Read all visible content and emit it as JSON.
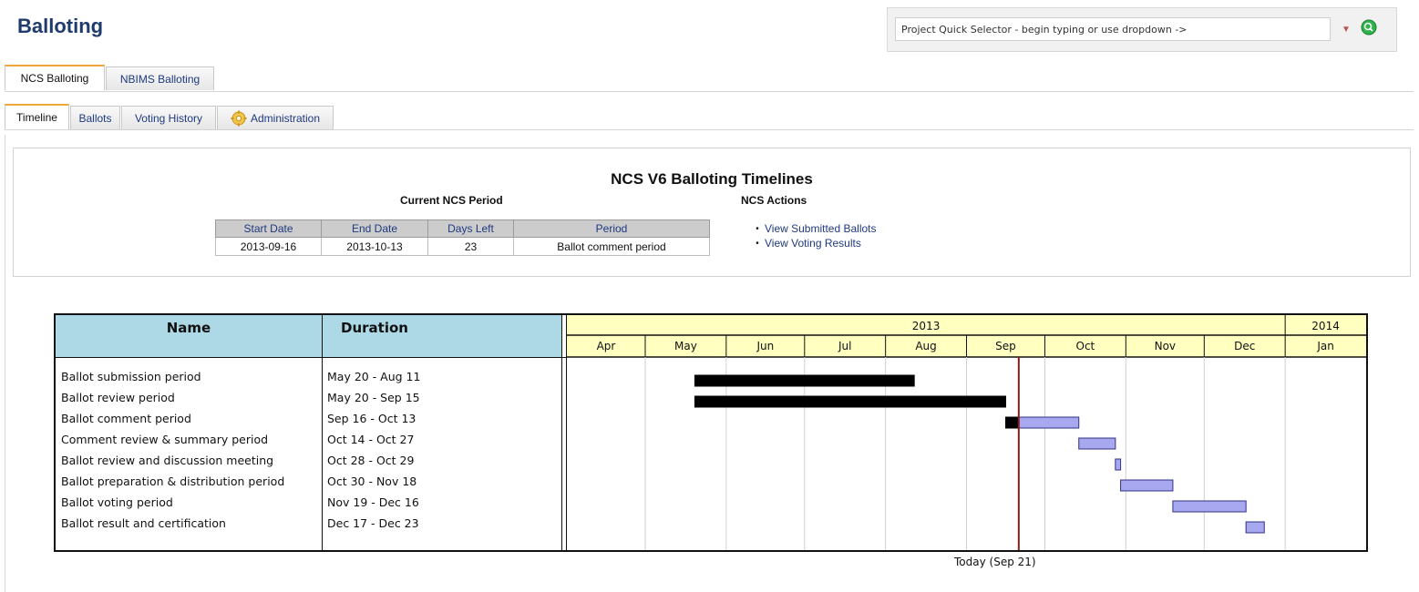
{
  "page": {
    "title": "Balloting"
  },
  "selector": {
    "placeholder": "Project Quick Selector - begin typing or use dropdown ->",
    "value": ""
  },
  "top_tabs": [
    {
      "label": "NCS Balloting",
      "active": true
    },
    {
      "label": "NBIMS Balloting",
      "active": false
    }
  ],
  "sub_tabs": [
    {
      "label": "Timeline",
      "active": true
    },
    {
      "label": "Ballots",
      "active": false
    },
    {
      "label": "Voting History",
      "active": false
    },
    {
      "label": "Administration",
      "active": false,
      "icon": "gear-icon"
    }
  ],
  "panel": {
    "title": "NCS V6 Balloting Timelines",
    "current_period_heading": "Current NCS Period",
    "actions_heading": "NCS Actions",
    "table": {
      "headers": [
        "Start Date",
        "End Date",
        "Days Left",
        "Period"
      ],
      "row": [
        "2013-09-16",
        "2013-10-13",
        "23",
        "Ballot comment period"
      ]
    },
    "actions": [
      "View Submitted Ballots",
      "View Voting Results"
    ]
  },
  "gantt": {
    "name_header": "Name",
    "duration_header": "Duration",
    "years": [
      {
        "label": "2013",
        "from": "2013-04-01",
        "to": "2014-01-01"
      },
      {
        "label": "2014",
        "from": "2014-01-01",
        "to": "2014-02-01"
      }
    ],
    "months": [
      "Apr",
      "May",
      "Jun",
      "Jul",
      "Aug",
      "Sep",
      "Oct",
      "Nov",
      "Dec",
      "Jan"
    ],
    "axis_start": "2013-04-01",
    "axis_end": "2014-02-01",
    "today": "2013-09-21",
    "today_label": "Today (Sep 21)",
    "tasks": [
      {
        "name": "Ballot submission period",
        "duration": "May 20 - Aug 11",
        "start": "2013-05-20",
        "end": "2013-08-11"
      },
      {
        "name": "Ballot review period",
        "duration": "May 20 - Sep 15",
        "start": "2013-05-20",
        "end": "2013-09-15"
      },
      {
        "name": "Ballot comment period",
        "duration": "Sep 16 - Oct 13",
        "start": "2013-09-16",
        "end": "2013-10-13"
      },
      {
        "name": "Comment review & summary period",
        "duration": "Oct 14 - Oct 27",
        "start": "2013-10-14",
        "end": "2013-10-27"
      },
      {
        "name": "Ballot review and discussion meeting",
        "duration": "Oct 28 - Oct 29",
        "start": "2013-10-28",
        "end": "2013-10-29"
      },
      {
        "name": "Ballot preparation & distribution period",
        "duration": "Oct 30 - Nov 18",
        "start": "2013-10-30",
        "end": "2013-11-18"
      },
      {
        "name": "Ballot voting period",
        "duration": "Nov 19 - Dec 16",
        "start": "2013-11-19",
        "end": "2013-12-16"
      },
      {
        "name": "Ballot result and certification",
        "duration": "Dec 17 - Dec 23",
        "start": "2013-12-17",
        "end": "2013-12-23"
      }
    ],
    "colors": {
      "header_blue": "#add8e6",
      "header_yellow": "#ffffc0",
      "past": "#000000",
      "future": "#a8a8f0",
      "today_line": "#8b1a1a"
    }
  }
}
